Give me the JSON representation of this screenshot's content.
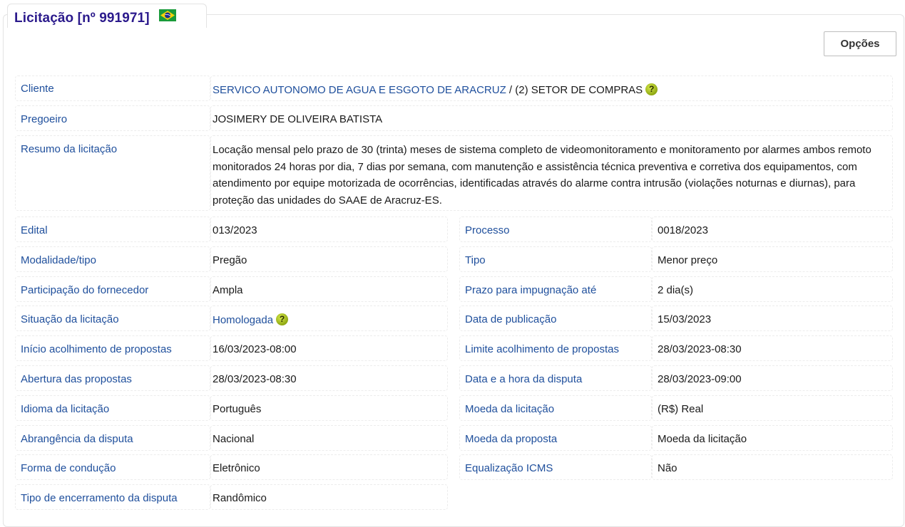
{
  "header": {
    "title": "Licitação [nº 991971]",
    "options_label": "Opções",
    "flag": "brazil-flag",
    "help_glyph": "?"
  },
  "cliente": {
    "label": "Cliente",
    "name": "SERVICO AUTONOMO DE AGUA E ESGOTO DE ARACRUZ",
    "sector": " / (2)  SETOR DE COMPRAS"
  },
  "pregoeiro": {
    "label": "Pregoeiro",
    "value": "JOSIMERY DE OLIVEIRA BATISTA"
  },
  "resumo": {
    "label": "Resumo da licitação",
    "value": "Locação mensal pelo prazo de 30 (trinta) meses de sistema completo de videomonitoramento e monitoramento por alarmes ambos remoto monitorados 24 horas por dia, 7 dias por semana, com manutenção e assistência técnica preventiva e corretiva dos equipamentos, com atendimento por equipe motorizada de ocorrências, identificadas através do alarme contra intrusão (violações noturnas e diurnas), para proteção das unidades do SAAE de Aracruz-ES."
  },
  "left_rows": [
    {
      "label": "Edital",
      "value": "013/2023"
    },
    {
      "label": "Modalidade/tipo",
      "value": "Pregão"
    },
    {
      "label": "Participação do fornecedor",
      "value": "Ampla"
    },
    {
      "label": "Situação da licitação",
      "value": "Homologada"
    },
    {
      "label": "Início acolhimento de propostas",
      "value": "16/03/2023-08:00"
    },
    {
      "label": "Abertura das propostas",
      "value": "28/03/2023-08:30"
    },
    {
      "label": "Idioma da licitação",
      "value": "Português"
    },
    {
      "label": "Abrangência da disputa",
      "value": "Nacional"
    },
    {
      "label": "Forma de condução",
      "value": "Eletrônico"
    },
    {
      "label": "Tipo de encerramento da disputa",
      "value": "Randômico"
    }
  ],
  "right_rows": [
    {
      "label": "Processo",
      "value": "0018/2023"
    },
    {
      "label": "Tipo",
      "value": "Menor preço"
    },
    {
      "label": "Prazo para impugnação até",
      "value": "2 dia(s)"
    },
    {
      "label": "Data de publicação",
      "value": "15/03/2023"
    },
    {
      "label": "Limite acolhimento de propostas",
      "value": "28/03/2023-08:30"
    },
    {
      "label": "Data e a hora da disputa",
      "value": "28/03/2023-09:00"
    },
    {
      "label": "Moeda da licitação",
      "value": "(R$) Real"
    },
    {
      "label": "Moeda da proposta",
      "value": "Moeda da licitação"
    },
    {
      "label": "Equalização ICMS",
      "value": "Não"
    }
  ]
}
